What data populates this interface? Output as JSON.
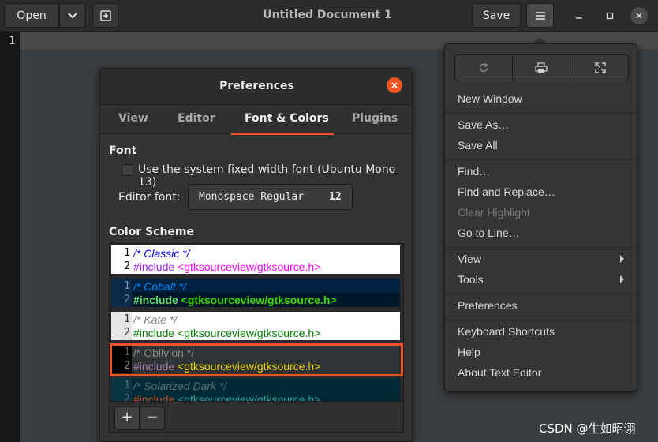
{
  "header": {
    "open_label": "Open",
    "title": "Untitled Document 1",
    "save_label": "Save"
  },
  "editor": {
    "line_number": "1"
  },
  "preferences": {
    "title": "Preferences",
    "tabs": [
      {
        "label": "View"
      },
      {
        "label": "Editor"
      },
      {
        "label": "Font & Colors",
        "active": true
      },
      {
        "label": "Plugins"
      }
    ],
    "font_section": "Font",
    "use_system_font_label": "Use the system fixed width font (Ubuntu Mono 13)",
    "use_system_font_checked": false,
    "editor_font_label": "Editor font:",
    "editor_font_name": "Monospace Regular",
    "editor_font_size": "12",
    "color_scheme_section": "Color Scheme",
    "schemes": [
      {
        "name": "Classic",
        "line1": "/* Classic */",
        "line2_kw": "#include",
        "line2_rest": " <gtksourceview/gtksource.h>",
        "n1": "1",
        "n2": "2"
      },
      {
        "name": "Cobalt",
        "line1": "/* Cobalt */",
        "line2_kw": "#include",
        "line2_rest": " <gtksourceview/gtksource.h>",
        "n1": "1",
        "n2": "2"
      },
      {
        "name": "Kate",
        "line1": "/* Kate */",
        "line2_kw": "#include",
        "line2_rest": " <gtksourceview/gtksource.h>",
        "n1": "1",
        "n2": "2"
      },
      {
        "name": "Oblivion",
        "line1": "/* Oblivion */",
        "line2_kw": "#include",
        "line2_rest": " <gtksourceview/gtksource.h>",
        "n1": "1",
        "n2": "2",
        "selected": true
      },
      {
        "name": "Solarized Dark",
        "line1": "/* Solarized Dark */",
        "line2_kw": "#include",
        "line2_rest": " <gtksourceview/gtksource.h>",
        "n1": "1",
        "n2": "2"
      }
    ],
    "add_label": "+",
    "remove_label": "−"
  },
  "menu": {
    "toolbar_icons": [
      "reload-icon",
      "print-icon",
      "fullscreen-icon"
    ],
    "items": [
      {
        "label": "New Window"
      },
      {
        "label": "Save As…"
      },
      {
        "label": "Save All"
      },
      {
        "label": "Find…"
      },
      {
        "label": "Find and Replace…"
      },
      {
        "label": "Clear Highlight",
        "disabled": true
      },
      {
        "label": "Go to Line…"
      },
      {
        "label": "View",
        "submenu": true
      },
      {
        "label": "Tools",
        "submenu": true
      },
      {
        "label": "Preferences"
      },
      {
        "label": "Keyboard Shortcuts"
      },
      {
        "label": "Help"
      },
      {
        "label": "About Text Editor"
      }
    ]
  },
  "watermark": "CSDN @生如昭诩",
  "colors": {
    "accent": "#e95420",
    "background": "#3a3a3a",
    "headerbar": "#2b2b2b"
  }
}
